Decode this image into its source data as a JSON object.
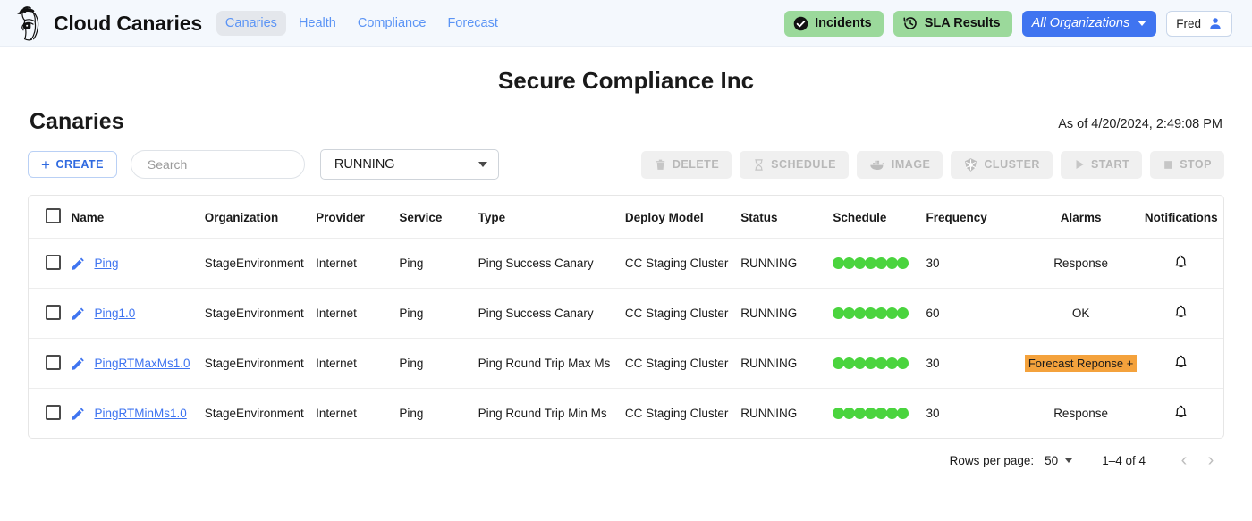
{
  "nav": {
    "logo_icon": "canary-bird-logo",
    "brand": "Cloud Canaries",
    "links": [
      {
        "label": "Canaries",
        "active": true
      },
      {
        "label": "Health",
        "active": false
      },
      {
        "label": "Compliance",
        "active": false
      },
      {
        "label": "Forecast",
        "active": false
      }
    ],
    "incidents_label": "Incidents",
    "incidents_icon": "check-circle-icon",
    "sla_label": "SLA Results",
    "sla_icon": "history-clock-icon",
    "org_selector_label": "All Organizations",
    "user_label": "Fred",
    "user_icon": "person-icon",
    "accent_blue": "#3f74f0",
    "pill_green": "#9bd99b"
  },
  "header": {
    "org_title": "Secure Compliance Inc",
    "page_title": "Canaries",
    "as_of": "As of 4/20/2024, 2:49:08 PM"
  },
  "toolbar": {
    "create_label": "CREATE",
    "create_plus": "+",
    "search_placeholder": "Search",
    "search_value": "",
    "search_icon": "search-icon",
    "status_filter_value": "RUNNING",
    "actions": [
      {
        "label": "DELETE",
        "icon": "trash-icon"
      },
      {
        "label": "SCHEDULE",
        "icon": "hourglass-icon"
      },
      {
        "label": "IMAGE",
        "icon": "docker-whale-icon"
      },
      {
        "label": "CLUSTER",
        "icon": "kubernetes-icon"
      },
      {
        "label": "START",
        "icon": "play-icon"
      },
      {
        "label": "STOP",
        "icon": "stop-square-icon"
      }
    ]
  },
  "table": {
    "columns": [
      "Name",
      "Organization",
      "Provider",
      "Service",
      "Type",
      "Deploy Model",
      "Status",
      "Schedule",
      "Frequency",
      "Alarms",
      "Notifications"
    ],
    "rows": [
      {
        "name": "Ping",
        "organization": "StageEnvironment",
        "provider": "Internet",
        "service": "Ping",
        "type": "Ping Success Canary",
        "deploy_model": "CC Staging Cluster",
        "status": "RUNNING",
        "schedule_dots": 7,
        "frequency": "30",
        "alarms": "Response",
        "alarms_highlighted": false,
        "notification_icon": "bell-icon"
      },
      {
        "name": "Ping1.0",
        "organization": "StageEnvironment",
        "provider": "Internet",
        "service": "Ping",
        "type": "Ping Success Canary",
        "deploy_model": "CC Staging Cluster",
        "status": "RUNNING",
        "schedule_dots": 7,
        "frequency": "60",
        "alarms": "OK",
        "alarms_highlighted": false,
        "notification_icon": "bell-icon"
      },
      {
        "name": "PingRTMaxMs1.0",
        "organization": "StageEnvironment",
        "provider": "Internet",
        "service": "Ping",
        "type": "Ping Round Trip Max Ms",
        "deploy_model": "CC Staging Cluster",
        "status": "RUNNING",
        "schedule_dots": 7,
        "frequency": "30",
        "alarms": "Forecast Reponse +",
        "alarms_highlighted": true,
        "notification_icon": "bell-icon"
      },
      {
        "name": "PingRTMinMs1.0",
        "organization": "StageEnvironment",
        "provider": "Internet",
        "service": "Ping",
        "type": "Ping Round Trip Min Ms",
        "deploy_model": "CC Staging Cluster",
        "status": "RUNNING",
        "schedule_dots": 7,
        "frequency": "30",
        "alarms": "Response",
        "alarms_highlighted": false,
        "notification_icon": "bell-icon"
      }
    ],
    "dot_color": "#4ad43e",
    "alarm_highlight_color": "#f4a23c"
  },
  "pagination": {
    "rows_per_page_label": "Rows per page:",
    "rows_per_page_value": "50",
    "range_label": "1–4 of 4",
    "prev_icon": "chevron-left-icon",
    "next_icon": "chevron-right-icon"
  }
}
